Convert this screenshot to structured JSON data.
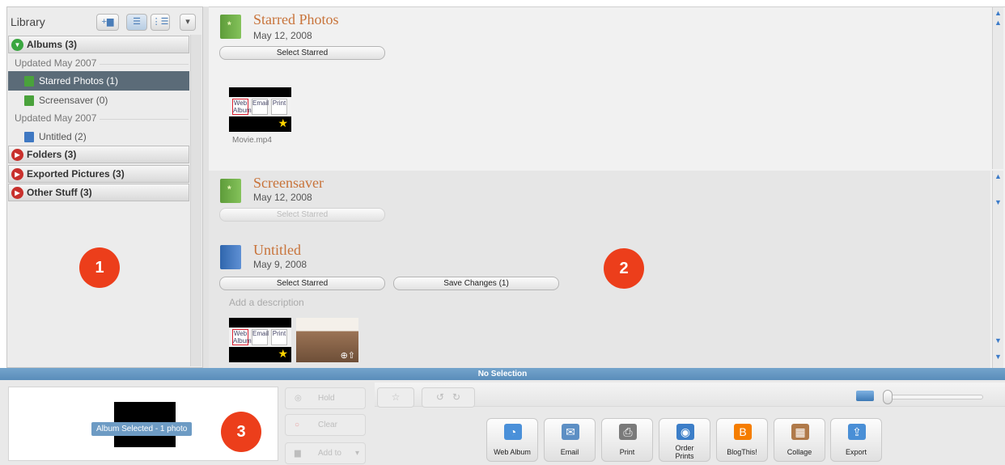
{
  "library": {
    "title": "Library",
    "sections": [
      {
        "label": "Albums (3)",
        "state": "expanded"
      },
      {
        "label": "Folders (3)",
        "state": "collapsed"
      },
      {
        "label": "Exported Pictures (3)",
        "state": "collapsed"
      },
      {
        "label": "Other Stuff (3)",
        "state": "collapsed"
      }
    ],
    "groups": [
      "Updated May 2007",
      "Updated May 2007"
    ],
    "items": [
      {
        "label": "Starred Photos (1)",
        "selected": true
      },
      {
        "label": "Screensaver (0)",
        "selected": false
      },
      {
        "label": "Untitled (2)",
        "selected": false
      }
    ]
  },
  "albums": [
    {
      "title": "Starred Photos",
      "date": "May 12, 2008",
      "buttons": [
        "Select Starred"
      ],
      "photos": [
        {
          "caption": "Movie.mp4"
        }
      ]
    },
    {
      "title": "Screensaver",
      "date": "May 12, 2008",
      "buttons": [
        "Select Starred"
      ]
    },
    {
      "title": "Untitled",
      "date": "May 9, 2008",
      "buttons": [
        "Select Starred",
        "Save Changes (1)"
      ],
      "description_placeholder": "Add a description"
    }
  ],
  "thumb_labels": [
    "Web Album",
    "Email",
    "Print"
  ],
  "status_bar": "No Selection",
  "tray": {
    "selection_badge": "Album Selected - 1 photo",
    "side_buttons": [
      "Hold",
      "Clear",
      "Add to"
    ]
  },
  "actions": [
    {
      "label": "Web Album",
      "icon": "web-album-icon",
      "color": "#4a90d9"
    },
    {
      "label": "Email",
      "icon": "email-icon",
      "color": "#5d8fc4"
    },
    {
      "label": "Print",
      "icon": "print-icon",
      "color": "#7a7a7a"
    },
    {
      "label": "Order Prints",
      "icon": "order-prints-icon",
      "color": "#3c7ec8"
    },
    {
      "label": "BlogThis!",
      "icon": "blogger-icon",
      "color": "#f57d00"
    },
    {
      "label": "Collage",
      "icon": "collage-icon",
      "color": "#b07a4a"
    },
    {
      "label": "Export",
      "icon": "export-icon",
      "color": "#4a8fd6"
    }
  ],
  "callouts": [
    "1",
    "2",
    "3"
  ]
}
